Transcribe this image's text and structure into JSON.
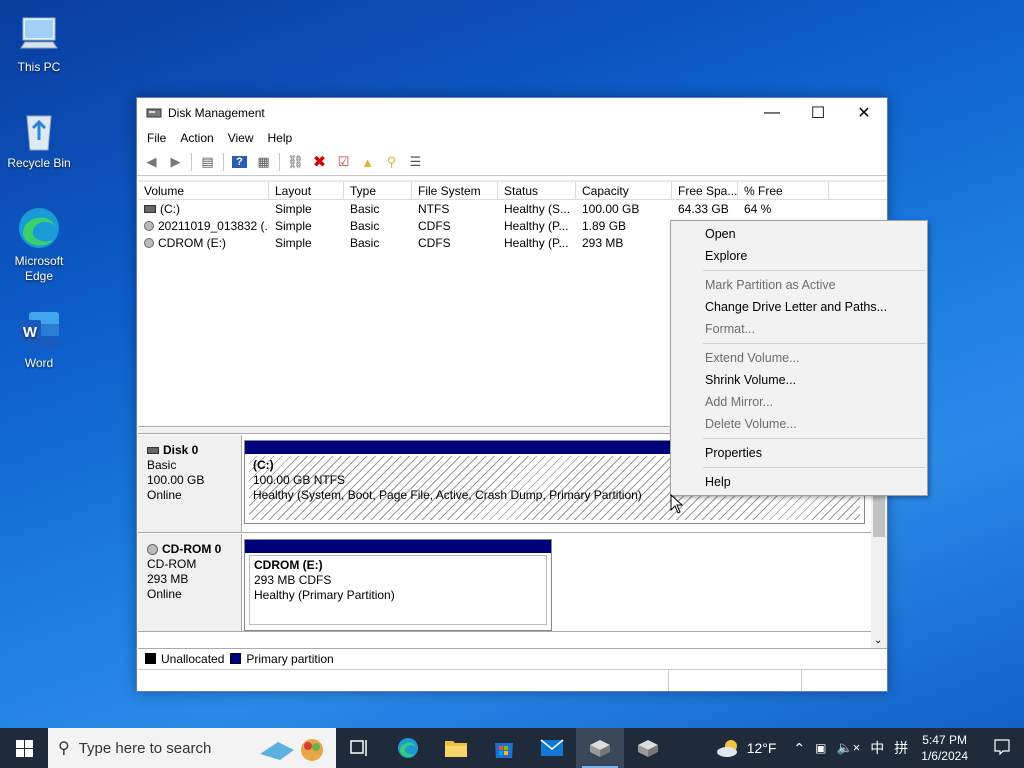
{
  "desktop": {
    "icons": [
      {
        "label": "This PC",
        "icon": "computer-icon"
      },
      {
        "label": "Recycle Bin",
        "icon": "recycle-bin-icon"
      },
      {
        "label": "Microsoft Edge",
        "icon": "edge-icon"
      },
      {
        "label": "Word",
        "icon": "word-icon"
      }
    ]
  },
  "window": {
    "title": "Disk Management",
    "menu": [
      "File",
      "Action",
      "View",
      "Help"
    ],
    "list": {
      "columns": [
        "Volume",
        "Layout",
        "Type",
        "File System",
        "Status",
        "Capacity",
        "Free Spa...",
        "% Free"
      ],
      "rows": [
        [
          "(C:)",
          "Simple",
          "Basic",
          "NTFS",
          "Healthy (S...",
          "100.00 GB",
          "64.33 GB",
          "64 %"
        ],
        [
          "20211019_013832 (...",
          "Simple",
          "Basic",
          "CDFS",
          "Healthy (P...",
          "1.89 GB",
          "",
          ""
        ],
        [
          "CDROM (E:)",
          "Simple",
          "Basic",
          "CDFS",
          "Healthy (P...",
          "293 MB",
          "",
          ""
        ]
      ]
    },
    "disks": [
      {
        "name": "Disk 0",
        "type": "Basic",
        "size": "100.00 GB",
        "status": "Online",
        "partition": {
          "name": "(C:)",
          "fs": "100.00 GB NTFS",
          "health": "Healthy (System, Boot, Page File, Active, Crash Dump, Primary Partition)"
        }
      },
      {
        "name": "CD-ROM 0",
        "type": "CD-ROM",
        "size": "293 MB",
        "status": "Online",
        "partition": {
          "name": "CDROM  (E:)",
          "fs": "293 MB CDFS",
          "health": "Healthy (Primary Partition)"
        }
      }
    ],
    "legend": [
      {
        "label": "Unallocated",
        "color": "#000000"
      },
      {
        "label": "Primary partition",
        "color": "#00007b"
      }
    ]
  },
  "context_menu": {
    "items": [
      {
        "label": "Open",
        "enabled": true
      },
      {
        "label": "Explore",
        "enabled": true
      },
      {
        "label": "Mark Partition as Active",
        "enabled": false
      },
      {
        "label": "Change Drive Letter and Paths...",
        "enabled": true
      },
      {
        "label": "Format...",
        "enabled": false
      },
      {
        "label": "Extend Volume...",
        "enabled": false
      },
      {
        "label": "Shrink Volume...",
        "enabled": true
      },
      {
        "label": "Add Mirror...",
        "enabled": false
      },
      {
        "label": "Delete Volume...",
        "enabled": false
      },
      {
        "label": "Properties",
        "enabled": true
      },
      {
        "label": "Help",
        "enabled": true
      }
    ]
  },
  "taskbar": {
    "search_placeholder": "Type here to search",
    "weather": "12°F",
    "ime": "中",
    "ime2": "拼",
    "time": "5:47 PM",
    "date": "1/6/2024"
  },
  "colors": {
    "primary_partition": "#00007b",
    "taskbar": "#1f2b3a"
  }
}
